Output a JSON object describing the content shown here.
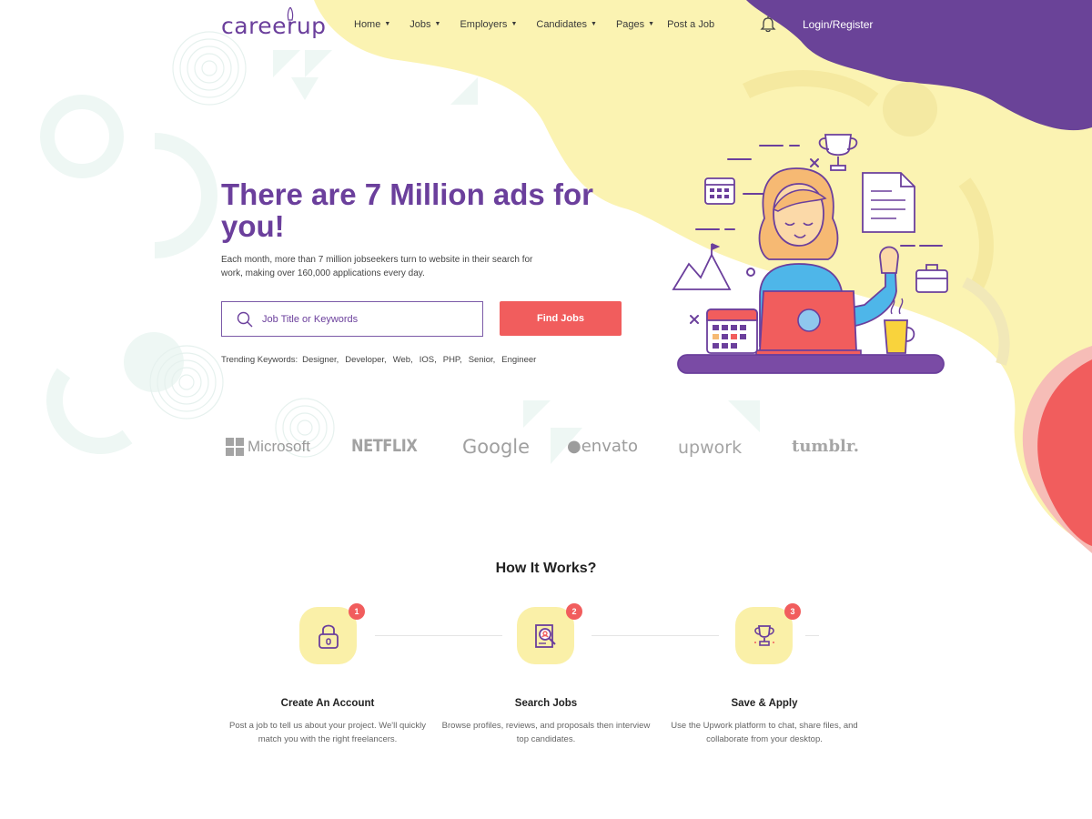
{
  "header": {
    "logo_text": "careerup",
    "nav": [
      {
        "label": "Home",
        "has_dropdown": true
      },
      {
        "label": "Jobs",
        "has_dropdown": true
      },
      {
        "label": "Employers",
        "has_dropdown": true
      },
      {
        "label": "Candidates",
        "has_dropdown": true
      },
      {
        "label": "Pages",
        "has_dropdown": true
      },
      {
        "label": "Post a Job",
        "has_dropdown": false
      }
    ],
    "login_label": "Login/Register",
    "notification_icon": "bell-icon"
  },
  "hero": {
    "title": "There are 7 Million ads for you!",
    "subtitle": "Each month, more than 7 million jobseekers turn to website in their search for work, making over 160,000 applications every day.",
    "search": {
      "placeholder": "Job Title or Keywords",
      "value": ""
    },
    "find_button": "Find Jobs",
    "trending_label": "Trending Keywords:",
    "trending_keywords": [
      "Designer,",
      "Developer,",
      "Web,",
      "IOS,",
      "PHP,",
      "Senior,",
      "Engineer"
    ]
  },
  "brands": [
    "Microsoft",
    "NETFLIX",
    "Google",
    "envato",
    "upwork",
    "tumblr."
  ],
  "how_it_works": {
    "title": "How It Works?",
    "steps": [
      {
        "number": "1",
        "icon": "lock-icon",
        "title": "Create An Account",
        "description": "Post a job to tell us about your project. We'll quickly match you with the right freelancers."
      },
      {
        "number": "2",
        "icon": "search-document-icon",
        "title": "Search Jobs",
        "description": "Browse profiles, reviews, and proposals then interview top candidates."
      },
      {
        "number": "3",
        "icon": "trophy-icon",
        "title": "Save & Apply",
        "description": "Use the Upwork platform to chat, share files, and collaborate from your desktop."
      }
    ]
  },
  "colors": {
    "brand_purple": "#6b3f9c",
    "accent_red": "#f15d5d",
    "blob_yellow": "#fbf3b2",
    "blob_purple": "#6a4398"
  }
}
